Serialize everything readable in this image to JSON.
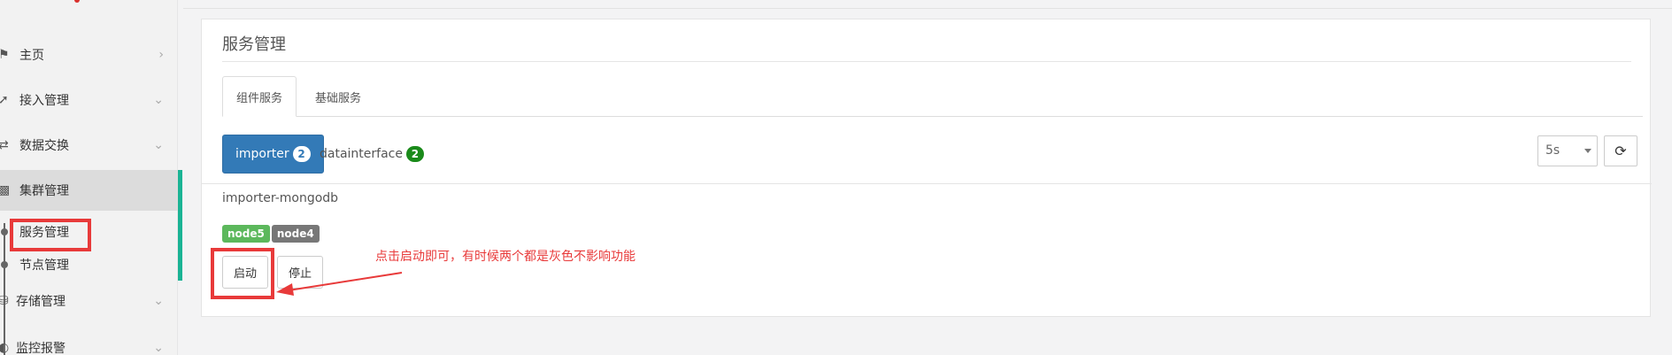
{
  "sidebar": {
    "items": [
      {
        "label": "主页",
        "icon": "home-icon",
        "chevron": "chevron-right-icon"
      },
      {
        "label": "接入管理",
        "icon": "plug-icon",
        "chevron": "chevron-down-icon"
      },
      {
        "label": "数据交换",
        "icon": "exchange-icon",
        "chevron": "chevron-down-icon"
      },
      {
        "label": "集群管理",
        "icon": "sitemap-icon",
        "chevron": ""
      },
      {
        "label": "存储管理",
        "icon": "database-icon",
        "chevron": "chevron-down-icon"
      },
      {
        "label": "监控报警",
        "icon": "dashboard-icon",
        "chevron": "chevron-down-icon"
      }
    ],
    "sub_items": [
      {
        "label": "服务管理"
      },
      {
        "label": "节点管理"
      }
    ],
    "colors": {
      "accent": "#1ab394"
    }
  },
  "page": {
    "title": "服务管理",
    "tabs": [
      {
        "label": "组件服务",
        "active": true
      },
      {
        "label": "基础服务",
        "active": false
      }
    ],
    "services": [
      {
        "name": "importer",
        "count": "2",
        "active": true
      },
      {
        "name": "datainterface",
        "count": "2",
        "active": false
      }
    ],
    "interval": {
      "value": "5s"
    },
    "refresh_icon": "refresh-icon",
    "service_detail": {
      "name": "importer-mongodb",
      "nodes": [
        {
          "label": "node5",
          "color": "#5cb85c"
        },
        {
          "label": "node4",
          "color": "#777777"
        }
      ],
      "start_label": "启动",
      "stop_label": "停止"
    }
  },
  "annotation": {
    "note": "点击启动即可，有时候两个都是灰色不影响功能",
    "color": "#e83a3a"
  }
}
